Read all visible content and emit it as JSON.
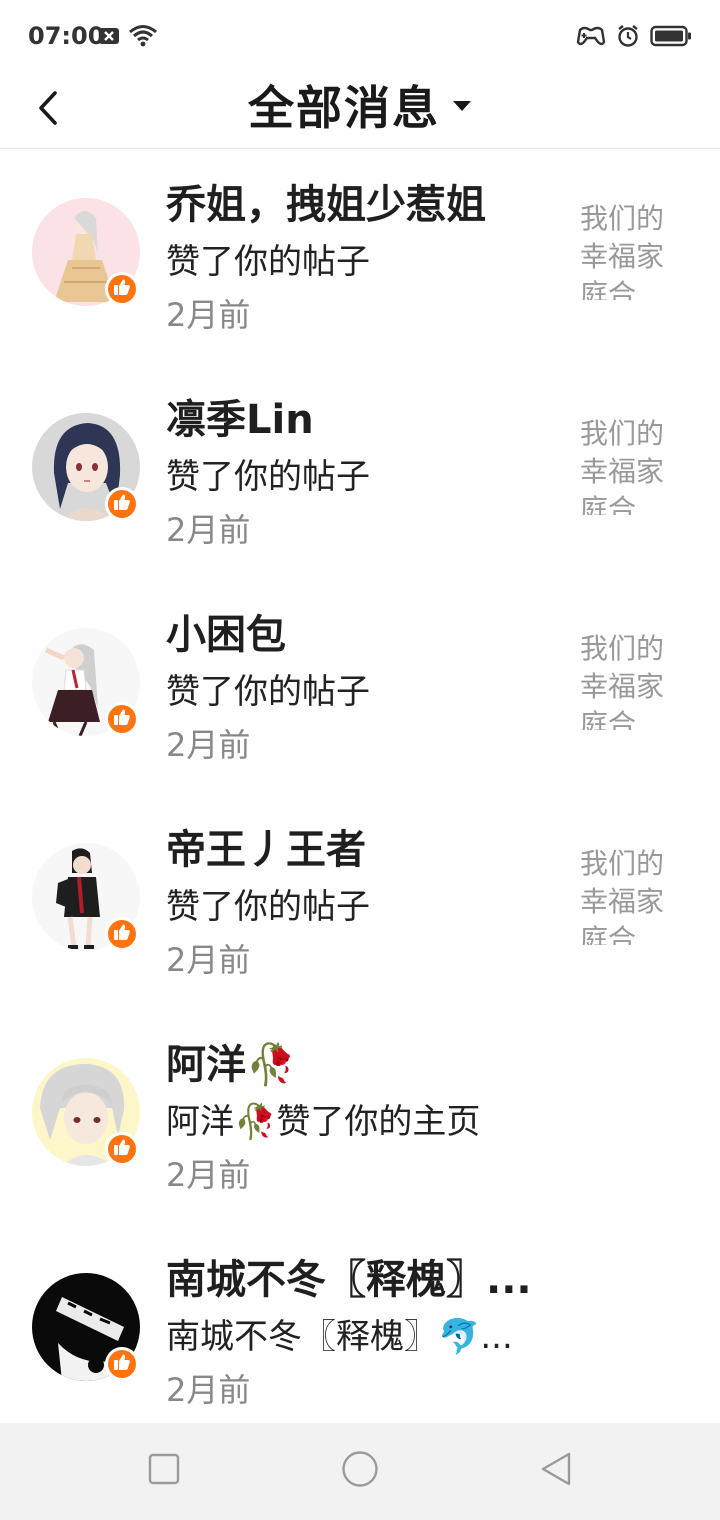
{
  "status_bar": {
    "time": "07:00",
    "left_icons": [
      "sim-x-icon",
      "wifi-icon"
    ],
    "right_icons": [
      "game-icon",
      "alarm-icon",
      "battery-icon"
    ]
  },
  "header": {
    "title": "全部消息",
    "back_icon": "back-icon",
    "dropdown_icon": "caret-down-icon"
  },
  "messages": [
    {
      "name": "乔姐，拽姐少惹姐",
      "action": "赞了你的帖子",
      "time": "2月前",
      "preview": "我们的幸福家庭合...",
      "badge_icon": "thumbs-up-icon"
    },
    {
      "name": "凛季Lin",
      "action": "赞了你的帖子",
      "time": "2月前",
      "preview": "我们的幸福家庭合...",
      "badge_icon": "thumbs-up-icon"
    },
    {
      "name": "小困包",
      "action": "赞了你的帖子",
      "time": "2月前",
      "preview": "我们的幸福家庭合...",
      "badge_icon": "thumbs-up-icon"
    },
    {
      "name": "帝王丿王者",
      "action": "赞了你的帖子",
      "time": "2月前",
      "preview": "我们的幸福家庭合...",
      "badge_icon": "thumbs-up-icon"
    },
    {
      "name": "阿洋🥀",
      "action": "阿洋🥀赞了你的主页",
      "time": "2月前",
      "preview": "",
      "badge_icon": "thumbs-up-icon"
    },
    {
      "name": "南城不冬〖释槐〗...",
      "action": "南城不冬〖释槐〗🐬...",
      "time": "2月前",
      "preview": "",
      "badge_icon": "thumbs-up-icon"
    }
  ],
  "nav_bar": {
    "icons": [
      "recent-apps-icon",
      "home-icon",
      "back-triangle-icon"
    ]
  },
  "colors": {
    "accent": "#ff7410",
    "muted_text": "#888888",
    "preview_text": "#999999",
    "nav_bg": "#f2f2f2"
  }
}
